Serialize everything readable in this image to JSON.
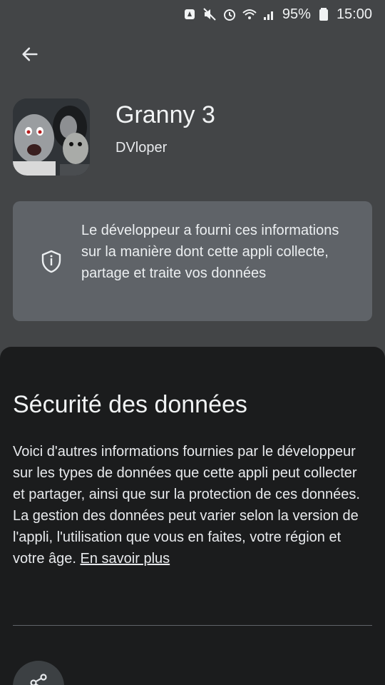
{
  "status_bar": {
    "battery_percent": "95%",
    "time": "15:00",
    "icons": [
      "notification-icon",
      "mute-icon",
      "alarm-icon",
      "wifi-icon",
      "signal-icon",
      "battery-icon"
    ]
  },
  "header": {
    "back_icon": "arrow-back-icon"
  },
  "app": {
    "title": "Granny 3",
    "developer": "DVloper"
  },
  "info_card": {
    "icon": "shield-icon",
    "text": "Le développeur a fourni ces informations sur la manière dont cette appli collecte, partage et traite vos données"
  },
  "sheet": {
    "title": "Sécurité des données",
    "body": "Voici d'autres informations fournies par le développeur sur les types de données que cette appli peut collecter et partager, ainsi que sur la protection de ces données. La gestion des données peut varier selon la version de l'appli, l'utilisation que vous en faites, votre région et votre âge.",
    "learn_more": "En savoir plus",
    "share_icon": "share-icon"
  },
  "colors": {
    "background": "#434547",
    "card": "#5f6368",
    "sheet": "#1b1c1d"
  }
}
